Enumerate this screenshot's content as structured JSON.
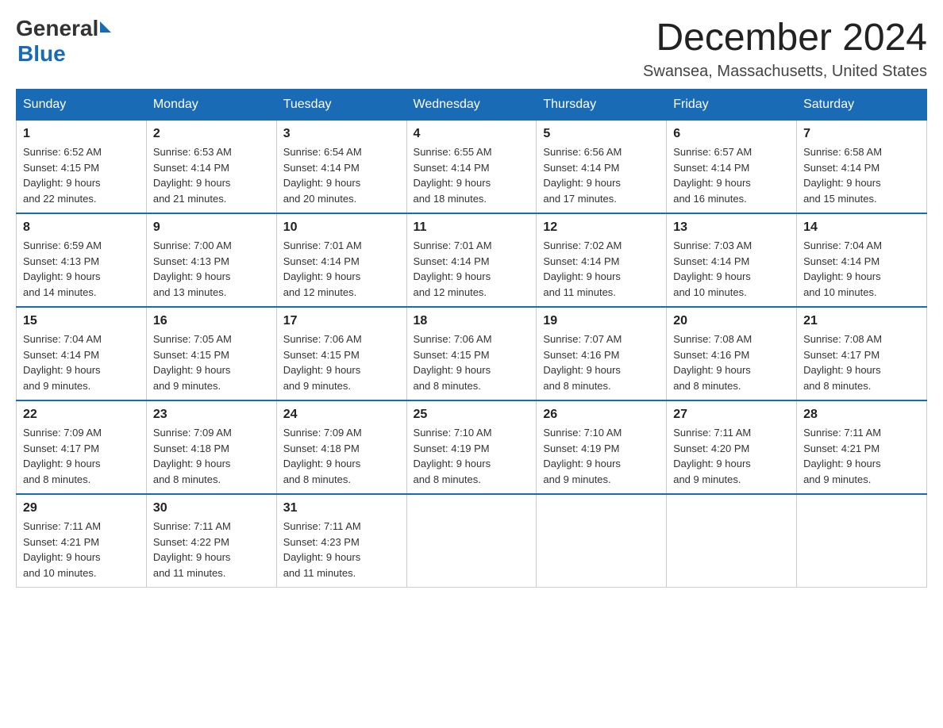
{
  "logo": {
    "general": "General",
    "blue": "Blue"
  },
  "title": "December 2024",
  "location": "Swansea, Massachusetts, United States",
  "days_of_week": [
    "Sunday",
    "Monday",
    "Tuesday",
    "Wednesday",
    "Thursday",
    "Friday",
    "Saturday"
  ],
  "weeks": [
    [
      {
        "day": "1",
        "sunrise": "6:52 AM",
        "sunset": "4:15 PM",
        "daylight": "9 hours and 22 minutes."
      },
      {
        "day": "2",
        "sunrise": "6:53 AM",
        "sunset": "4:14 PM",
        "daylight": "9 hours and 21 minutes."
      },
      {
        "day": "3",
        "sunrise": "6:54 AM",
        "sunset": "4:14 PM",
        "daylight": "9 hours and 20 minutes."
      },
      {
        "day": "4",
        "sunrise": "6:55 AM",
        "sunset": "4:14 PM",
        "daylight": "9 hours and 18 minutes."
      },
      {
        "day": "5",
        "sunrise": "6:56 AM",
        "sunset": "4:14 PM",
        "daylight": "9 hours and 17 minutes."
      },
      {
        "day": "6",
        "sunrise": "6:57 AM",
        "sunset": "4:14 PM",
        "daylight": "9 hours and 16 minutes."
      },
      {
        "day": "7",
        "sunrise": "6:58 AM",
        "sunset": "4:14 PM",
        "daylight": "9 hours and 15 minutes."
      }
    ],
    [
      {
        "day": "8",
        "sunrise": "6:59 AM",
        "sunset": "4:13 PM",
        "daylight": "9 hours and 14 minutes."
      },
      {
        "day": "9",
        "sunrise": "7:00 AM",
        "sunset": "4:13 PM",
        "daylight": "9 hours and 13 minutes."
      },
      {
        "day": "10",
        "sunrise": "7:01 AM",
        "sunset": "4:14 PM",
        "daylight": "9 hours and 12 minutes."
      },
      {
        "day": "11",
        "sunrise": "7:01 AM",
        "sunset": "4:14 PM",
        "daylight": "9 hours and 12 minutes."
      },
      {
        "day": "12",
        "sunrise": "7:02 AM",
        "sunset": "4:14 PM",
        "daylight": "9 hours and 11 minutes."
      },
      {
        "day": "13",
        "sunrise": "7:03 AM",
        "sunset": "4:14 PM",
        "daylight": "9 hours and 10 minutes."
      },
      {
        "day": "14",
        "sunrise": "7:04 AM",
        "sunset": "4:14 PM",
        "daylight": "9 hours and 10 minutes."
      }
    ],
    [
      {
        "day": "15",
        "sunrise": "7:04 AM",
        "sunset": "4:14 PM",
        "daylight": "9 hours and 9 minutes."
      },
      {
        "day": "16",
        "sunrise": "7:05 AM",
        "sunset": "4:15 PM",
        "daylight": "9 hours and 9 minutes."
      },
      {
        "day": "17",
        "sunrise": "7:06 AM",
        "sunset": "4:15 PM",
        "daylight": "9 hours and 9 minutes."
      },
      {
        "day": "18",
        "sunrise": "7:06 AM",
        "sunset": "4:15 PM",
        "daylight": "9 hours and 8 minutes."
      },
      {
        "day": "19",
        "sunrise": "7:07 AM",
        "sunset": "4:16 PM",
        "daylight": "9 hours and 8 minutes."
      },
      {
        "day": "20",
        "sunrise": "7:08 AM",
        "sunset": "4:16 PM",
        "daylight": "9 hours and 8 minutes."
      },
      {
        "day": "21",
        "sunrise": "7:08 AM",
        "sunset": "4:17 PM",
        "daylight": "9 hours and 8 minutes."
      }
    ],
    [
      {
        "day": "22",
        "sunrise": "7:09 AM",
        "sunset": "4:17 PM",
        "daylight": "9 hours and 8 minutes."
      },
      {
        "day": "23",
        "sunrise": "7:09 AM",
        "sunset": "4:18 PM",
        "daylight": "9 hours and 8 minutes."
      },
      {
        "day": "24",
        "sunrise": "7:09 AM",
        "sunset": "4:18 PM",
        "daylight": "9 hours and 8 minutes."
      },
      {
        "day": "25",
        "sunrise": "7:10 AM",
        "sunset": "4:19 PM",
        "daylight": "9 hours and 8 minutes."
      },
      {
        "day": "26",
        "sunrise": "7:10 AM",
        "sunset": "4:19 PM",
        "daylight": "9 hours and 9 minutes."
      },
      {
        "day": "27",
        "sunrise": "7:11 AM",
        "sunset": "4:20 PM",
        "daylight": "9 hours and 9 minutes."
      },
      {
        "day": "28",
        "sunrise": "7:11 AM",
        "sunset": "4:21 PM",
        "daylight": "9 hours and 9 minutes."
      }
    ],
    [
      {
        "day": "29",
        "sunrise": "7:11 AM",
        "sunset": "4:21 PM",
        "daylight": "9 hours and 10 minutes."
      },
      {
        "day": "30",
        "sunrise": "7:11 AM",
        "sunset": "4:22 PM",
        "daylight": "9 hours and 11 minutes."
      },
      {
        "day": "31",
        "sunrise": "7:11 AM",
        "sunset": "4:23 PM",
        "daylight": "9 hours and 11 minutes."
      },
      null,
      null,
      null,
      null
    ]
  ]
}
